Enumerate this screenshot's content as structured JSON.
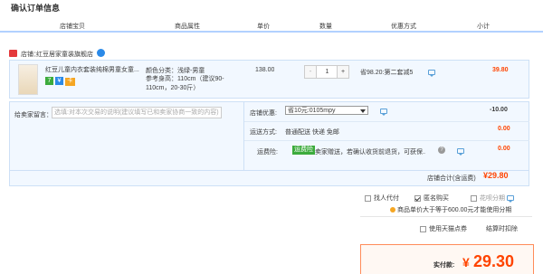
{
  "page_title": "确认订单信息",
  "columns": [
    "店铺宝贝",
    "商品属性",
    "单价",
    "数量",
    "优惠方式",
    "小计"
  ],
  "shop": {
    "label": "店铺：",
    "name": "红豆居家童装旗舰店"
  },
  "item": {
    "title": "红豆儿童内衣套装纯棉男童女童...",
    "attr_color": "颜色分类：浅绿-男童",
    "attr_size": "参考身高：110cm（建议90-110cm，20-30斤）",
    "price": "138.00",
    "qty_minus": "-",
    "qty": "1",
    "qty_plus": "+",
    "promo": "省98.20:第二套减5",
    "subtotal": "39.80",
    "badges": [
      "7",
      "¥",
      "卡"
    ]
  },
  "message": {
    "label": "给卖家留言：",
    "placeholder": "选填:对本次交易的说明(建议填写已和卖家协商一致的内容)"
  },
  "discount": {
    "label": "店铺优惠:",
    "selected": "省10元:0105mpy",
    "value": "-10.00"
  },
  "shipping": {
    "label": "运送方式:",
    "value": "普通配送 快递 免邮",
    "amount": "0.00"
  },
  "insurance": {
    "label": "运费险:",
    "tag": "运费险",
    "desc": "卖家赠送，若确认收货前退货，可获保...",
    "amount": "0.00"
  },
  "shop_total": {
    "label": "店铺合计(含运费)",
    "value": "¥29.80"
  },
  "options": {
    "proxy": "找人代付",
    "anonymous": "匿名购买",
    "installment": "花呗分期",
    "installment_note": "商品单价大于等于600.00元才能使用分期",
    "tmall_points": "使用天猫点券",
    "settle": "结算时扣除"
  },
  "pay": {
    "label": "实付款:",
    "currency": "¥",
    "amount": "29.30"
  },
  "colors": {
    "accent": "#ff4400",
    "blue": "#3c88d8",
    "border": "#b7d0ea",
    "light_bg": "#f6fbff"
  }
}
